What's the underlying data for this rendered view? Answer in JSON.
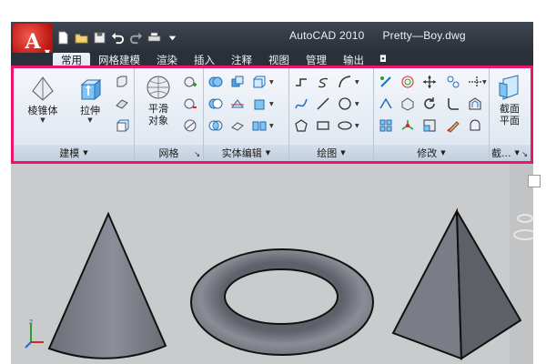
{
  "titlebar": {
    "app_name": "AutoCAD 2010",
    "document": "Pretty—Boy.dwg"
  },
  "app_logo": "A",
  "tabs": [
    {
      "label": "常用",
      "active": true
    },
    {
      "label": "网格建模"
    },
    {
      "label": "渲染"
    },
    {
      "label": "插入"
    },
    {
      "label": "注释"
    },
    {
      "label": "视图"
    },
    {
      "label": "管理"
    },
    {
      "label": "输出"
    }
  ],
  "ribbon": {
    "panels": {
      "modeling": {
        "title": "建模",
        "pyramid_label": "棱锥体",
        "extrude_label": "拉伸"
      },
      "mesh": {
        "title": "网格",
        "smooth_label_1": "平滑",
        "smooth_label_2": "对象"
      },
      "solid_edit": {
        "title": "实体编辑"
      },
      "draw": {
        "title": "绘图"
      },
      "modify": {
        "title": "修改"
      },
      "section": {
        "title": "截...",
        "section_label_1": "截面",
        "section_label_2": "平面"
      }
    }
  },
  "colors": {
    "highlight_border": "#e8176b",
    "title_bar": "#2a3038",
    "viewport_bg": "#c9cbcd"
  }
}
